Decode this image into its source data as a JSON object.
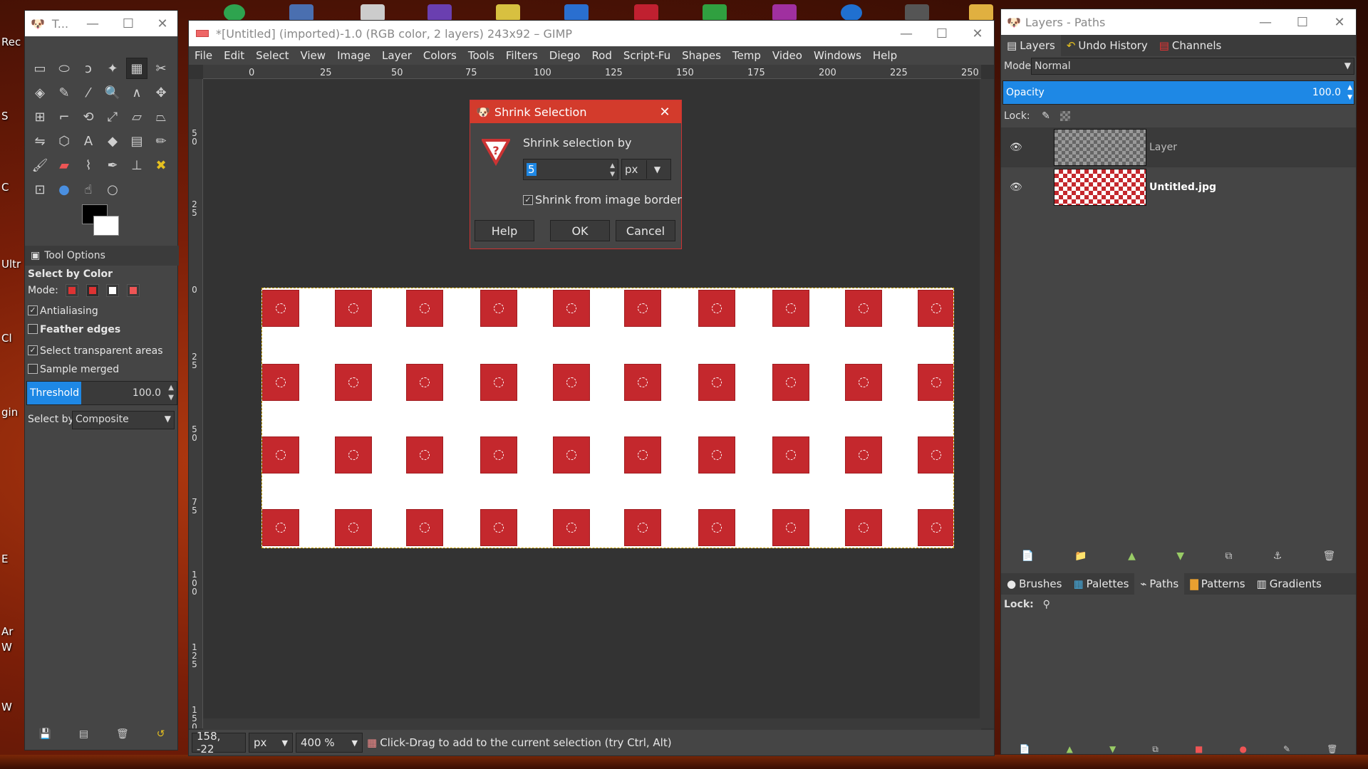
{
  "desktop": {
    "left_labels": [
      "Rec",
      "S",
      "C",
      "Ultr",
      "gin",
      "Cl",
      "E",
      "Ar",
      "W",
      "W"
    ]
  },
  "toolbox": {
    "title": "T...",
    "tool_options_tab": "Tool Options",
    "tool_name": "Select by Color",
    "mode_label": "Mode:",
    "antialiasing": "Antialiasing",
    "feather_edges": "Feather edges",
    "select_transparent": "Select transparent areas",
    "sample_merged": "Sample merged",
    "threshold_label": "Threshold",
    "threshold_value": "100.0",
    "threshold_fraction": 0.36,
    "select_by_label": "Select by:",
    "select_by_value": "Composite"
  },
  "main": {
    "title": "*[Untitled] (imported)-1.0 (RGB color, 2 layers) 243x92 – GIMP",
    "menu": [
      "File",
      "Edit",
      "Select",
      "View",
      "Image",
      "Layer",
      "Colors",
      "Tools",
      "Filters",
      "Diego",
      "Rod",
      "Script-Fu",
      "Shapes",
      "Temp",
      "Video",
      "Windows",
      "Help"
    ],
    "ruler_h": [
      "0",
      "25",
      "50",
      "75",
      "100",
      "125",
      "150",
      "175",
      "200",
      "225",
      "250"
    ],
    "ruler_v": [
      "5 0",
      "2 5",
      "0",
      "2 5",
      "5 0",
      "7 5",
      "1 0 0",
      "1 2 5",
      "1 5 0"
    ],
    "status": {
      "coords": "158, -22",
      "unit": "px",
      "zoom": "400 %",
      "message": "Click-Drag to add to the current selection (try Ctrl, Alt)"
    }
  },
  "dialog": {
    "title": "Shrink Selection",
    "label": "Shrink selection by",
    "value": "5",
    "unit": "px",
    "checkbox": "Shrink from image border",
    "help": "Help",
    "ok": "OK",
    "cancel": "Cancel"
  },
  "dock": {
    "title": "Layers - Paths",
    "tabs": [
      "Layers",
      "Undo History",
      "Channels"
    ],
    "mode_label": "Mode:",
    "mode_value": "Normal",
    "opacity_label": "Opacity",
    "opacity_value": "100.0",
    "lock_label": "Lock:",
    "layers": [
      {
        "name": "Layer"
      },
      {
        "name": "Untitled.jpg"
      }
    ],
    "tabs2": [
      "Brushes",
      "Palettes",
      "Paths",
      "Patterns",
      "Gradients"
    ],
    "lock2_label": "Lock:"
  },
  "colors": {
    "accent": "#1e88e5",
    "dialog_title": "#d33b2c",
    "square_red": "#c4282d"
  }
}
